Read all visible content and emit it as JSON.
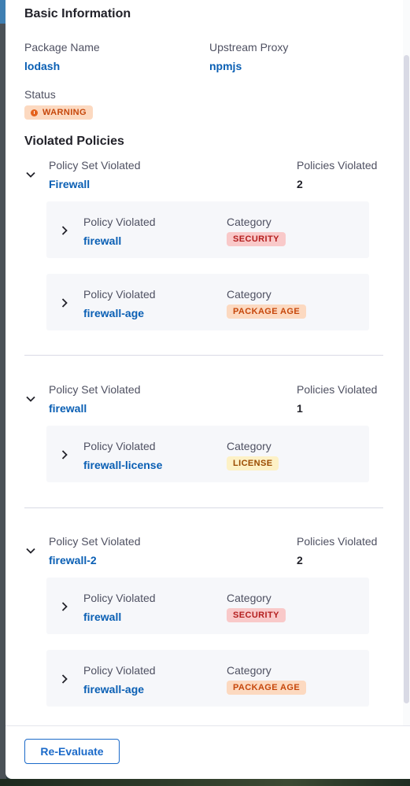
{
  "basic": {
    "title": "Basic Information",
    "package_name_label": "Package Name",
    "package_name_value": "lodash",
    "upstream_label": "Upstream Proxy",
    "upstream_value": "npmjs",
    "status_label": "Status",
    "status_value": "WARNING"
  },
  "violated": {
    "title": "Violated Policies",
    "groups": [
      {
        "set_label": "Policy Set Violated",
        "set_value": "Firewall",
        "count_label": "Policies Violated",
        "count_value": "2",
        "policies": [
          {
            "policy_label": "Policy Violated",
            "policy_value": "firewall",
            "category_label": "Category",
            "category_value": "SECURITY"
          },
          {
            "policy_label": "Policy Violated",
            "policy_value": "firewall-age",
            "category_label": "Category",
            "category_value": "PACKAGE AGE"
          }
        ]
      },
      {
        "set_label": "Policy Set Violated",
        "set_value": "firewall",
        "count_label": "Policies Violated",
        "count_value": "1",
        "policies": [
          {
            "policy_label": "Policy Violated",
            "policy_value": "firewall-license",
            "category_label": "Category",
            "category_value": "LICENSE"
          }
        ]
      },
      {
        "set_label": "Policy Set Violated",
        "set_value": "firewall-2",
        "count_label": "Policies Violated",
        "count_value": "2",
        "policies": [
          {
            "policy_label": "Policy Violated",
            "policy_value": "firewall",
            "category_label": "Category",
            "category_value": "SECURITY"
          },
          {
            "policy_label": "Policy Violated",
            "policy_value": "firewall-age",
            "category_label": "Category",
            "category_value": "PACKAGE AGE"
          }
        ]
      }
    ]
  },
  "footer": {
    "reevaluate_label": "Re-Evaluate"
  },
  "colors": {
    "link": "#0a5fb4",
    "warning_bg": "#fcd9c0",
    "security_bg": "#f9c9c9",
    "license_bg": "#fdf1c6",
    "button_border": "#1b6ac9"
  }
}
